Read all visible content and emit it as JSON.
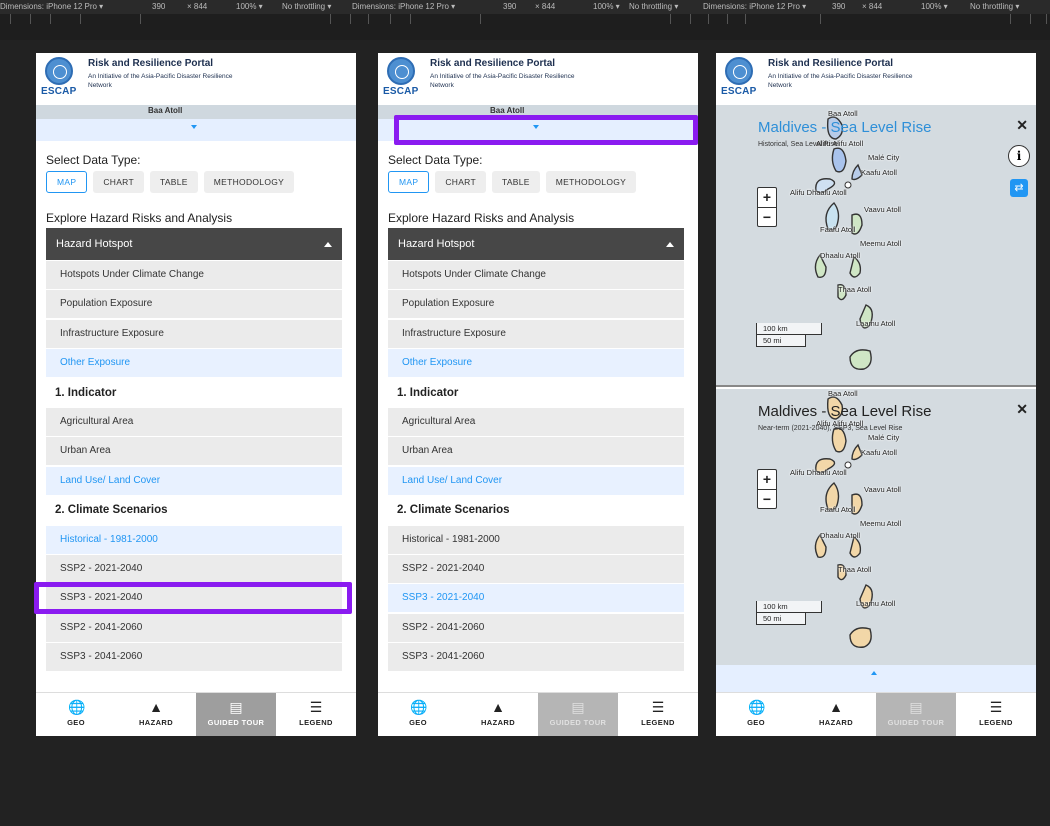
{
  "devtools": {
    "bars": [
      {
        "device": "Dimensions: iPhone 12 Pro ▾",
        "w": "390",
        "h": "× 844",
        "zoom": "100% ▾",
        "throttle": "No throttling ▾"
      },
      {
        "device": "Dimensions: iPhone 12 Pro ▾",
        "w": "390",
        "h": "× 844",
        "zoom": "100% ▾",
        "throttle": "No throttling ▾"
      },
      {
        "device": "Dimensions: iPhone 12 Pro ▾",
        "w": "390",
        "h": "× 844",
        "zoom": "100% ▾",
        "throttle": "No throttling ▾"
      }
    ]
  },
  "header": {
    "title": "Risk and Resilience Portal",
    "subtitle": "An Initiative of the Asia-Pacific Disaster Resilience Network",
    "logo_text": "ESCAP"
  },
  "map_strip_label": "Baa Atoll",
  "data_type": {
    "label": "Select Data Type:",
    "buttons": [
      "MAP",
      "CHART",
      "TABLE",
      "METHODOLOGY"
    ]
  },
  "explore_title": "Explore Hazard Risks and Analysis",
  "accordion_title": "Hazard Hotspot",
  "exposure_items": [
    "Hotspots Under Climate Change",
    "Population Exposure",
    "Infrastructure Exposure",
    "Other Exposure"
  ],
  "indicator_title": "1. Indicator",
  "indicator_items": [
    "Agricultural Area",
    "Urban Area",
    "Land Use/ Land Cover"
  ],
  "scenario_title": "2. Climate Scenarios",
  "scenario_items": [
    "Historical - 1981-2000",
    "SSP2 - 2021-2040",
    "SSP3 - 2021-2040",
    "SSP2 - 2041-2060",
    "SSP3 - 2041-2060"
  ],
  "bottom_nav": [
    {
      "label": "GEO",
      "icon": "globe-icon"
    },
    {
      "label": "HAZARD",
      "icon": "warning-icon"
    },
    {
      "label": "GUIDED TOUR",
      "icon": "book-icon"
    },
    {
      "label": "LEGEND",
      "icon": "list-icon"
    }
  ],
  "map_panels": [
    {
      "title": "Maldives - Sea Level Rise",
      "subtitle": "Historical, Sea Level Rise"
    },
    {
      "title": "Maldives - Sea Level Rise",
      "subtitle": "Near-term (2021-2040), SSP3, Sea Level Rise"
    }
  ],
  "map_labels": {
    "baa": "Baa Atoll",
    "alifu_alifu": "Alifu Alifu Atoll",
    "male": "Malé City",
    "kaafu": "Kaafu Atoll",
    "alifu_dhaalu": "Alifu Dhaalu Atoll",
    "vaavu": "Vaavu Atoll",
    "faafu": "Faafu Atoll",
    "meemu": "Meemu Atoll",
    "dhaalu": "Dhaalu Atoll",
    "thaa": "Thaa Atoll",
    "laamu": "Laamu Atoll"
  },
  "map_controls": {
    "zoom_in": "+",
    "zoom_out": "−",
    "close": "✕",
    "info": "i",
    "swap": "⇄",
    "scale_km": "100 km",
    "scale_mi": "50 mi"
  },
  "colors": {
    "accent": "#2196f3",
    "highlight": "#8a1bf0",
    "accordion_bg": "#474747"
  }
}
